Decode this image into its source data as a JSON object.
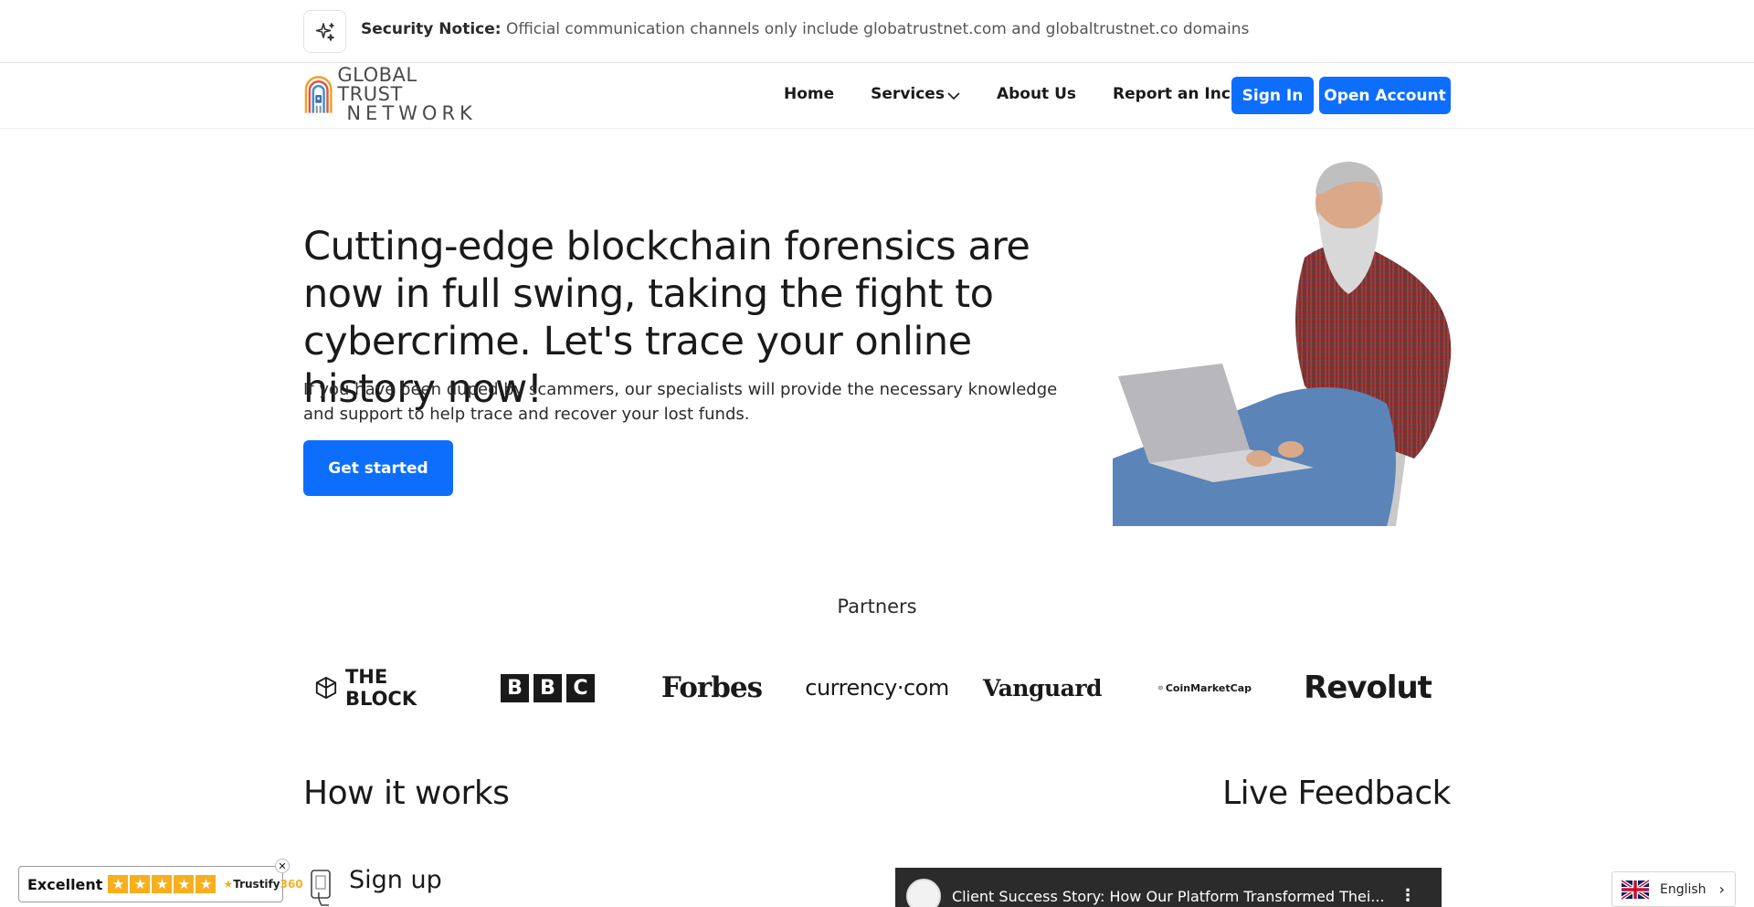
{
  "notice": {
    "icon": "sparkle-icon",
    "label": "Security Notice:",
    "text": " Official communication channels only include globatrustnet.com and globaltrustnet.co domains"
  },
  "header": {
    "logo_line1": "GLOBAL TRUST",
    "logo_line2": "NETWORK",
    "nav": [
      {
        "label": "Home"
      },
      {
        "label": "Services"
      },
      {
        "label": "About Us"
      },
      {
        "label": "Report an Incident"
      }
    ],
    "sign_in": "Sign In",
    "open_account": "Open Account"
  },
  "hero": {
    "title": "Cutting-edge blockchain forensics are now in full swing, taking the fight to cybercrime. Let's trace your online history now!",
    "subtitle": "If you have been duped by scammers, our specialists will provide the necessary knowledge and support to help trace and recover your lost funds.",
    "cta": "Get started"
  },
  "partners": {
    "title": "Partners",
    "logos": [
      "THE BLOCK",
      "BBC",
      "Forbes",
      "currency·com",
      "Vanguard",
      "CoinMarketCap",
      "Revolut"
    ]
  },
  "sections": {
    "how_it_works": "How it works",
    "live_feedback": "Live Feedback",
    "first_step": "Sign up"
  },
  "video": {
    "title": "Client Success Story: How Our Platform Transformed Thei..."
  },
  "trust_widget": {
    "label": "Excellent",
    "rating_stars": 5,
    "brand_prefix": "Trustify",
    "brand_suffix": "360"
  },
  "language": {
    "label": "English"
  },
  "colors": {
    "accent": "#0d6efd",
    "star": "#f6b01e"
  }
}
